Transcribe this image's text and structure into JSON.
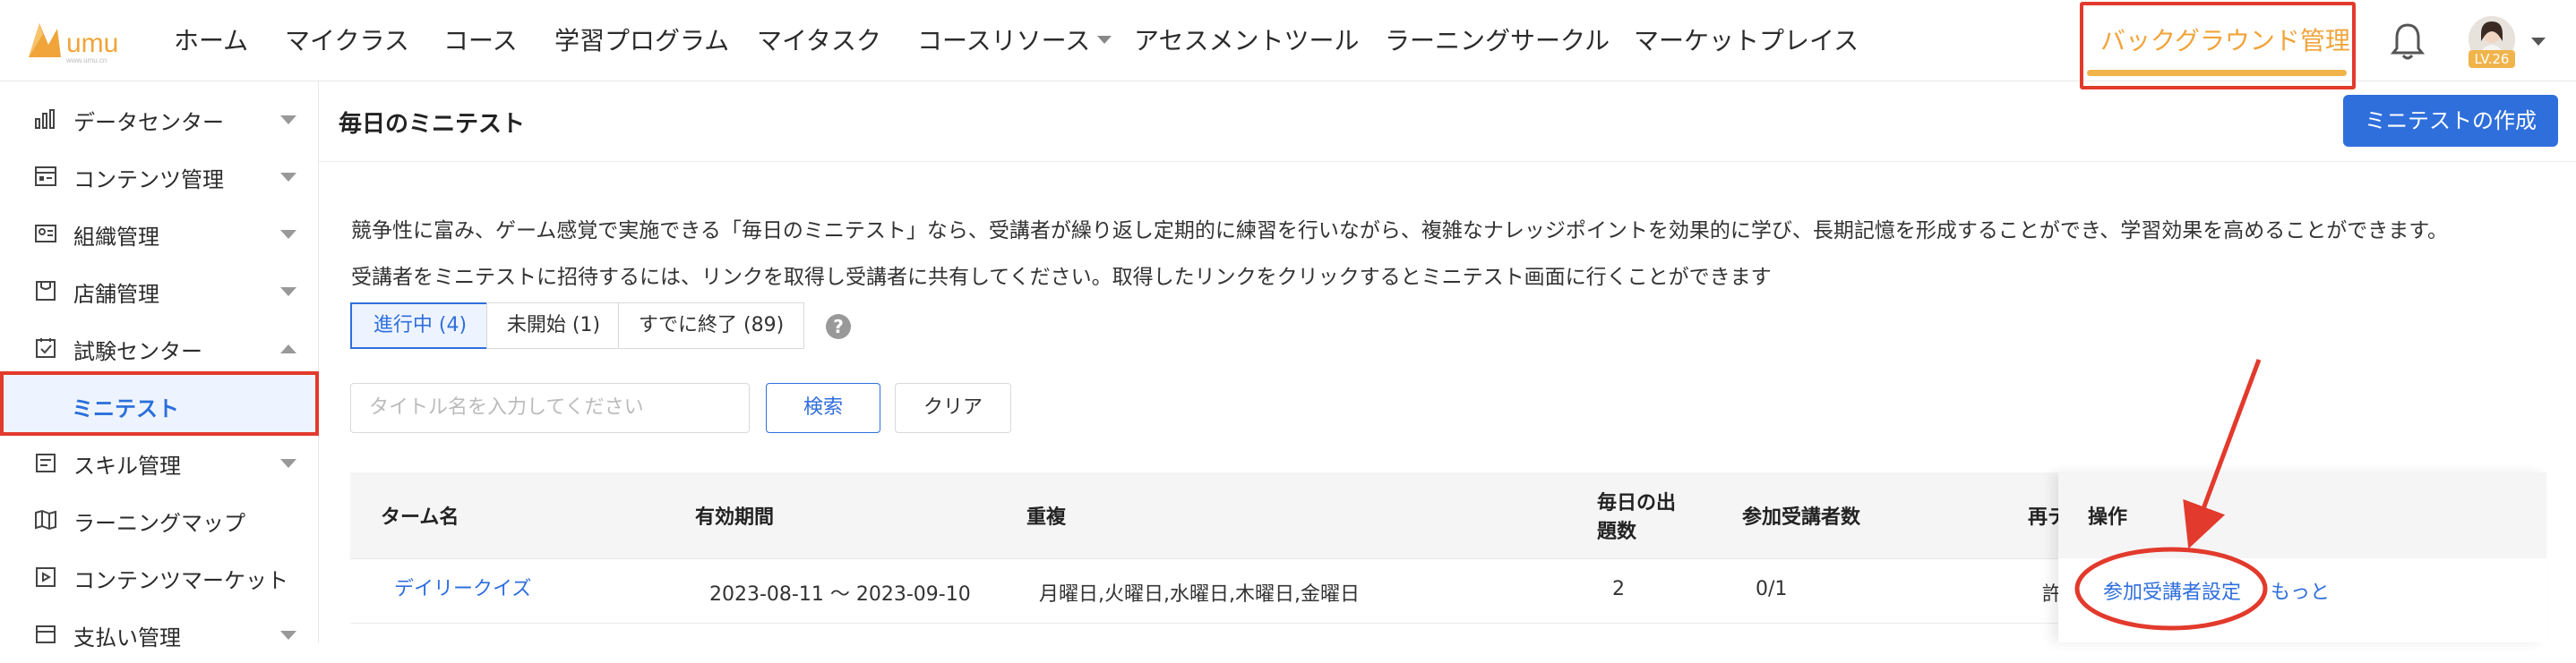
{
  "header": {
    "logo_text": "umu",
    "logo_subtext": "www.umu.cn",
    "nav": [
      {
        "label": "ホーム"
      },
      {
        "label": "マイクラス"
      },
      {
        "label": "コース"
      },
      {
        "label": "学習プログラム"
      },
      {
        "label": "マイタスク"
      },
      {
        "label": "コースリソース",
        "has_dropdown": true
      },
      {
        "label": "アセスメントツール"
      },
      {
        "label": "ラーニングサークル"
      },
      {
        "label": "マーケットプレイス"
      }
    ],
    "background_manage_label": "バックグラウンド管理",
    "user_level": "LV.26",
    "bell_icon": "bell-icon"
  },
  "sidebar": {
    "items": [
      {
        "label": "データセンター",
        "icon": "bar-chart-icon",
        "expand": "down"
      },
      {
        "label": "コンテンツ管理",
        "icon": "content-icon",
        "expand": "down"
      },
      {
        "label": "組織管理",
        "icon": "id-card-icon",
        "expand": "down"
      },
      {
        "label": "店舗管理",
        "icon": "store-icon",
        "expand": "down"
      },
      {
        "label": "試験センター",
        "icon": "exam-icon",
        "expand": "up"
      },
      {
        "label": "ミニテスト",
        "active": true
      },
      {
        "label": "スキル管理",
        "icon": "skill-icon",
        "expand": "down"
      },
      {
        "label": "ラーニングマップ",
        "icon": "map-icon"
      },
      {
        "label": "コンテンツマーケット",
        "icon": "market-icon"
      },
      {
        "label": "支払い管理",
        "icon": "payment-icon",
        "expand": "down"
      }
    ]
  },
  "main": {
    "title": "毎日のミニテスト",
    "create_button": "ミニテストの作成",
    "description_1": "競争性に富み、ゲーム感覚で実施できる「毎日のミニテスト」なら、受講者が繰り返し定期的に練習を行いながら、複雑なナレッジポイントを効果的に学び、長期記憶を形成することができ、学習効果を高めることができます。",
    "description_2": "受講者をミニテストに招待するには、リンクを取得し受講者に共有してください。取得したリンクをクリックするとミニテスト画面に行くことができます",
    "tabs": [
      {
        "label": "進行中 (4)",
        "active": true
      },
      {
        "label": "未開始 (1)"
      },
      {
        "label": "すでに終了 (89)"
      }
    ],
    "help_icon": "?",
    "search": {
      "placeholder": "タイトル名を入力してください",
      "search_label": "検索",
      "clear_label": "クリア"
    },
    "table": {
      "headers": {
        "term_name": "ターム名",
        "period": "有効期間",
        "repeat": "重複",
        "daily_count_1": "毎日の出",
        "daily_count_2": "題数",
        "participants": "参加受講者数",
        "retry": "再テ",
        "actions": "操作"
      },
      "rows": [
        {
          "term_name": "デイリークイズ",
          "period": "2023-08-11 ～ 2023-09-10",
          "repeat": "月曜日,火曜日,水曜日,木曜日,金曜日",
          "daily_count": "2",
          "participants": "0/1",
          "retry": "許",
          "action_participants": "参加受講者設定",
          "action_more": "もっと"
        }
      ]
    }
  },
  "colors": {
    "accent": "#2f6fdc",
    "highlight": "#e23a2c",
    "orange": "#f0a43a"
  }
}
